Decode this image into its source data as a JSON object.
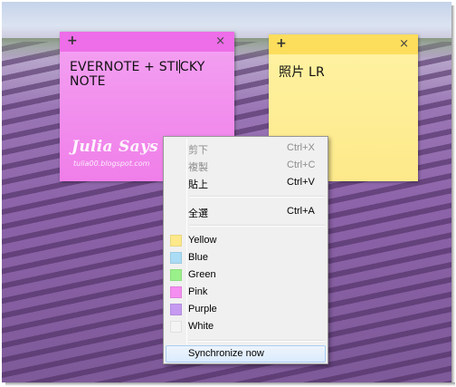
{
  "notes": [
    {
      "color": "pink",
      "add_label": "+",
      "close_label": "×",
      "text_before_caret": "EVERNOTE + STI",
      "text_after_caret": "CKY NOTE",
      "watermark": "Julia Says",
      "watermark_sub": "tulia00.blogspot.com"
    },
    {
      "color": "yellow",
      "add_label": "+",
      "close_label": "×",
      "text": "照片 LR"
    }
  ],
  "menu": {
    "edit": [
      {
        "label": "剪下",
        "shortcut": "Ctrl+X",
        "enabled": false
      },
      {
        "label": "複製",
        "shortcut": "Ctrl+C",
        "enabled": false
      },
      {
        "label": "貼上",
        "shortcut": "Ctrl+V",
        "enabled": true
      }
    ],
    "select_all": {
      "label": "全選",
      "shortcut": "Ctrl+A"
    },
    "colors": [
      {
        "label": "Yellow",
        "swatch": "#fde98a"
      },
      {
        "label": "Blue",
        "swatch": "#aadcf5"
      },
      {
        "label": "Green",
        "swatch": "#9af08a"
      },
      {
        "label": "Pink",
        "swatch": "#f48ef0"
      },
      {
        "label": "Purple",
        "swatch": "#c59af0"
      },
      {
        "label": "White",
        "swatch": "#f4f4f4"
      }
    ],
    "sync": {
      "label": "Synchronize now"
    }
  }
}
